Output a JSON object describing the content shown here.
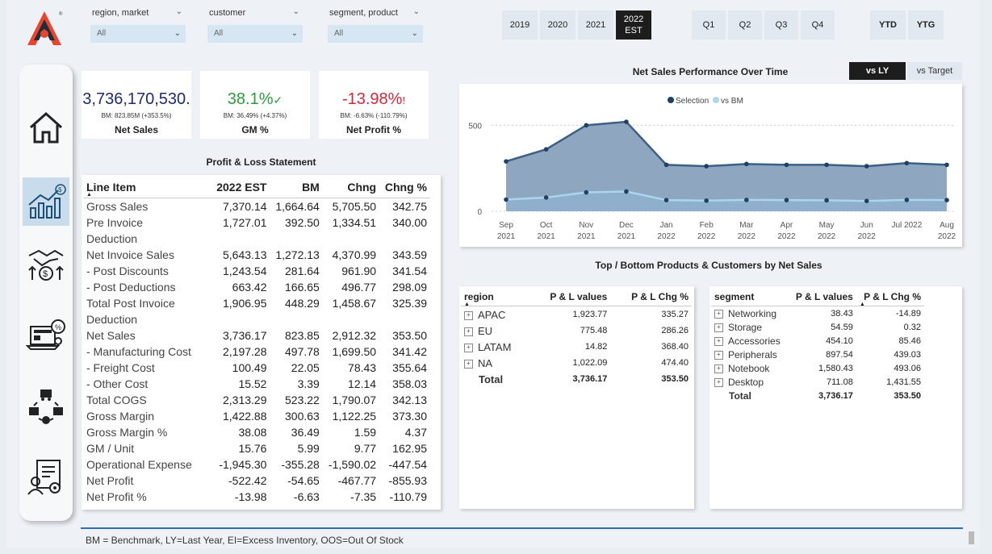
{
  "filters": [
    {
      "label": "region, market",
      "value": "All"
    },
    {
      "label": "customer",
      "value": "All"
    },
    {
      "label": "segment, product",
      "value": "All"
    }
  ],
  "years": [
    "2019",
    "2020",
    "2021"
  ],
  "year_active": {
    "line1": "2022",
    "line2": "EST"
  },
  "quarters": [
    "Q1",
    "Q2",
    "Q3",
    "Q4"
  ],
  "ytd": [
    "YTD",
    "YTG"
  ],
  "nav": [
    "home-icon",
    "chart-icon",
    "handshake-icon",
    "gear-laptop-icon",
    "supply-chain-icon",
    "report-icon"
  ],
  "kpis": [
    {
      "value": "3,736,170,530.",
      "bm": "BM: 823.85M (+353.5%)",
      "label": "Net Sales",
      "color": "#1f2b6f"
    },
    {
      "value": "38.1%",
      "mark": "✓",
      "bm": "BM: 36.49% (+4.37%)",
      "label": "GM %",
      "color": "#2c9b3b"
    },
    {
      "value": "-13.98%",
      "mark": "!",
      "bm": "BM: -6.63% (-110.79%)",
      "label": "Net Profit %",
      "color": "#d6263a"
    }
  ],
  "pl": {
    "title": "Profit & Loss Statement",
    "headers": [
      "Line Item",
      "2022 EST",
      "BM",
      "Chng",
      "Chng %"
    ],
    "rows": [
      {
        "item": "Gross Sales",
        "a": "7,370.14",
        "b": "1,664.64",
        "c": "5,705.50",
        "d": "342.75"
      },
      {
        "item": "Pre Invoice",
        "item2": "Deduction",
        "a": "1,727.01",
        "b": "392.50",
        "c": "1,334.51",
        "d": "340.00"
      },
      {
        "item": "Net Invoice Sales",
        "a": "5,643.13",
        "b": "1,272.13",
        "c": "4,370.99",
        "d": "343.59"
      },
      {
        "item": "- Post Discounts",
        "a": "1,243.54",
        "b": "281.64",
        "c": "961.90",
        "d": "341.54"
      },
      {
        "item": "- Post Deductions",
        "a": "663.42",
        "b": "166.65",
        "c": "496.77",
        "d": "298.09"
      },
      {
        "item": "Total Post Invoice",
        "item2": "Deduction",
        "a": "1,906.95",
        "b": "448.29",
        "c": "1,458.67",
        "d": "325.39"
      },
      {
        "item": "Net Sales",
        "a": "3,736.17",
        "b": "823.85",
        "c": "2,912.32",
        "d": "353.50"
      },
      {
        "item": "- Manufacturing Cost",
        "a": "2,197.28",
        "b": "497.78",
        "c": "1,699.50",
        "d": "341.42"
      },
      {
        "item": "- Freight Cost",
        "a": "100.49",
        "b": "22.05",
        "c": "78.43",
        "d": "355.64"
      },
      {
        "item": "- Other Cost",
        "a": "15.52",
        "b": "3.39",
        "c": "12.14",
        "d": "358.03"
      },
      {
        "item": "Total COGS",
        "a": "2,313.29",
        "b": "523.22",
        "c": "1,790.07",
        "d": "342.13"
      },
      {
        "item": "Gross Margin",
        "a": "1,422.88",
        "b": "300.63",
        "c": "1,122.25",
        "d": "373.30"
      },
      {
        "item": "Gross Margin %",
        "a": "38.08",
        "b": "36.49",
        "c": "1.59",
        "d": "4.37"
      },
      {
        "item": "GM / Unit",
        "a": "15.76",
        "b": "5.99",
        "c": "9.77",
        "d": "162.95"
      },
      {
        "item": "Operational Expense",
        "a": "-1,945.30",
        "b": "-355.28",
        "c": "-1,590.02",
        "d": "-447.54"
      },
      {
        "item": "Net Profit",
        "a": "-522.42",
        "b": "-54.65",
        "c": "-467.77",
        "d": "-855.93"
      },
      {
        "item": "Net Profit %",
        "a": "-13.98",
        "b": "-6.63",
        "c": "-7.35",
        "d": "-110.79"
      }
    ]
  },
  "chart_title": "Net Sales Performance Over Time",
  "vs": [
    "vs LY",
    "vs Target"
  ],
  "chart_data": {
    "type": "area",
    "x": [
      "Sep 2021",
      "Oct 2021",
      "Nov 2021",
      "Dec 2021",
      "Jan 2022",
      "Feb 2022",
      "Mar 2022",
      "Apr 2022",
      "May 2022",
      "Jun 2022",
      "Jul 2022",
      "Aug 2022"
    ],
    "x_line1": [
      "Sep",
      "Oct",
      "Nov",
      "Dec",
      "Jan",
      "Feb",
      "Mar",
      "Apr",
      "May",
      "Jun",
      "Jul 2022",
      "Aug"
    ],
    "x_line2": [
      "2021",
      "2021",
      "2021",
      "2021",
      "2022",
      "2022",
      "2022",
      "2022",
      "2022",
      "2022",
      "",
      "2022"
    ],
    "series": [
      {
        "name": "Selection",
        "color": "#1f3f63",
        "values": [
          290,
          360,
          500,
          520,
          270,
          262,
          275,
          270,
          270,
          262,
          280,
          270
        ]
      },
      {
        "name": "vs BM",
        "color": "#a9d6ee",
        "values": [
          68,
          80,
          110,
          115,
          65,
          62,
          66,
          65,
          64,
          60,
          66,
          65
        ]
      }
    ],
    "yticks": [
      0,
      500
    ],
    "ylim": [
      0,
      600
    ],
    "legend": "top-center",
    "grid": true
  },
  "tb_title": "Top / Bottom Products & Customers by Net Sales",
  "region_table": {
    "headers": [
      "region",
      "P & L values",
      "P & L Chg %"
    ],
    "rows": [
      {
        "name": "APAC",
        "v": "1,923.77",
        "c": "335.27"
      },
      {
        "name": "EU",
        "v": "775.48",
        "c": "286.26"
      },
      {
        "name": "LATAM",
        "v": "14.82",
        "c": "368.40"
      },
      {
        "name": "NA",
        "v": "1,022.09",
        "c": "474.40"
      }
    ],
    "total": {
      "name": "Total",
      "v": "3,736.17",
      "c": "353.50"
    }
  },
  "segment_table": {
    "headers": [
      "segment",
      "P & L values",
      "P & L Chg %"
    ],
    "rows": [
      {
        "name": "Networking",
        "v": "38.43",
        "c": "-14.89"
      },
      {
        "name": "Storage",
        "v": "54.59",
        "c": "0.32"
      },
      {
        "name": "Accessories",
        "v": "454.10",
        "c": "85.46"
      },
      {
        "name": "Peripherals",
        "v": "897.54",
        "c": "439.03"
      },
      {
        "name": "Notebook",
        "v": "1,580.43",
        "c": "493.06"
      },
      {
        "name": "Desktop",
        "v": "711.08",
        "c": "1,431.55"
      }
    ],
    "total": {
      "name": "Total",
      "v": "3,736.17",
      "c": "353.50"
    }
  },
  "footer": "BM = Benchmark, LY=Last Year, EI=Excess Inventory, OOS=Out Of Stock"
}
